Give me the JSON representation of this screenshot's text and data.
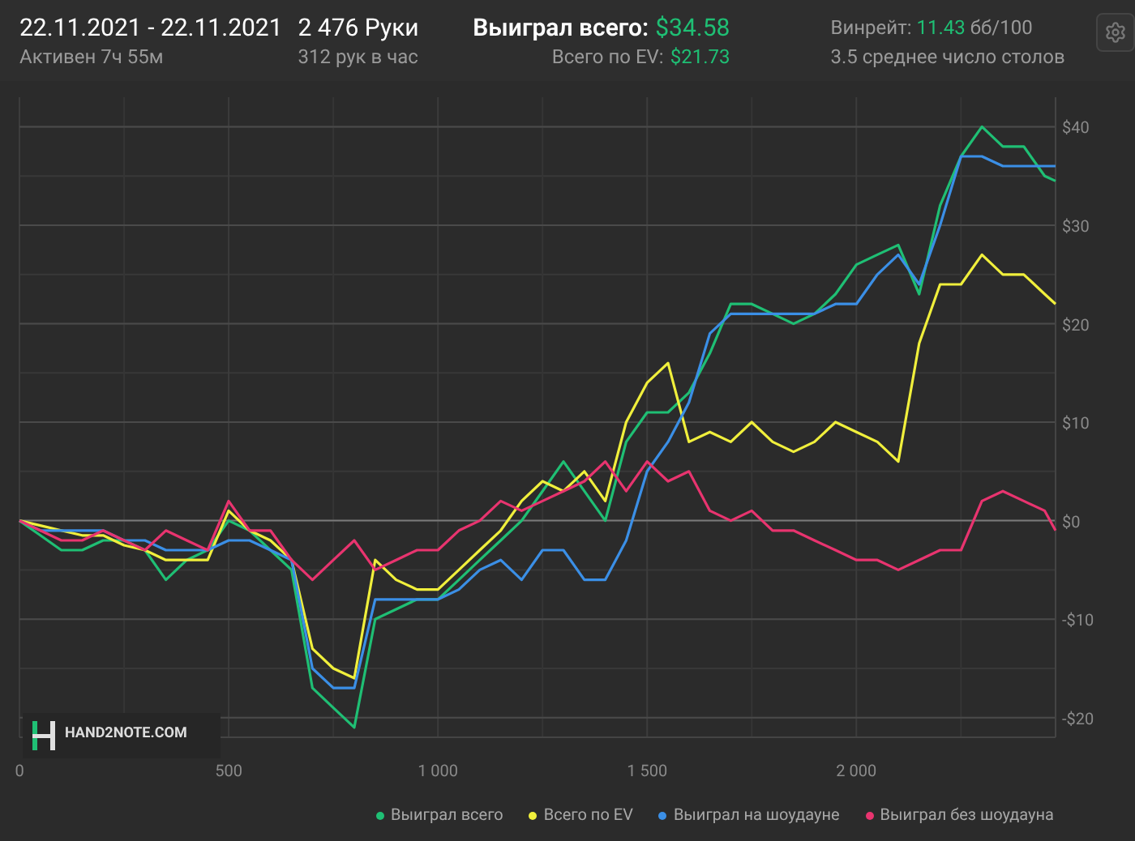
{
  "header": {
    "date_range": "22.11.2021 - 22.11.2021",
    "active": "Активен 7ч 55м",
    "hands": "2 476 Руки",
    "hands_per_hour": "312 рук в час",
    "won_label": "Выиграл всего:",
    "won_value": "$34.58",
    "ev_label": "Всего по EV:",
    "ev_value": "$21.73",
    "winrate_label": "Винрейт:",
    "winrate_value": "11.43",
    "winrate_unit": "бб/100",
    "tables": "3.5 среднее число столов"
  },
  "logo": {
    "text": "HAND2NOTE.COM"
  },
  "chart": {
    "chart_data": {
      "type": "line",
      "x": [
        0,
        50,
        100,
        150,
        200,
        250,
        300,
        350,
        400,
        450,
        500,
        550,
        600,
        650,
        700,
        750,
        800,
        850,
        900,
        950,
        1000,
        1050,
        1100,
        1150,
        1200,
        1250,
        1300,
        1350,
        1400,
        1450,
        1500,
        1550,
        1600,
        1650,
        1700,
        1750,
        1800,
        1850,
        1900,
        1950,
        2000,
        2050,
        2100,
        2150,
        2200,
        2250,
        2300,
        2350,
        2400,
        2450,
        2476
      ],
      "series": [
        {
          "name": "Выиграл всего",
          "color": "#1fbf74",
          "values": [
            0,
            -1.5,
            -3,
            -3,
            -2,
            -2,
            -3,
            -6,
            -4,
            -3,
            0,
            -1,
            -3,
            -5,
            -17,
            -19,
            -21,
            -10,
            -9,
            -8,
            -8,
            -6,
            -4,
            -2,
            0,
            3,
            6,
            3,
            0,
            8,
            11,
            11,
            13,
            17,
            22,
            22,
            21,
            20,
            21,
            23,
            26,
            27,
            28,
            23,
            32,
            37,
            40,
            38,
            38,
            35,
            34.5
          ]
        },
        {
          "name": "Всего по EV",
          "color": "#f0ef3c",
          "values": [
            0,
            -0.5,
            -1,
            -1.5,
            -1.5,
            -2.5,
            -3,
            -4,
            -4,
            -4,
            1,
            -1,
            -2,
            -4,
            -13,
            -15,
            -16,
            -4,
            -6,
            -7,
            -7,
            -5,
            -3,
            -1,
            2,
            4,
            3,
            5,
            2,
            10,
            14,
            16,
            8,
            9,
            8,
            10,
            8,
            7,
            8,
            10,
            9,
            8,
            6,
            18,
            24,
            24,
            27,
            25,
            25,
            23,
            22
          ]
        },
        {
          "name": "Выиграл на шоудауне",
          "color": "#3b8fe6",
          "values": [
            0,
            -1,
            -1,
            -1,
            -1,
            -2,
            -2,
            -3,
            -3,
            -3,
            -2,
            -2,
            -3,
            -4,
            -15,
            -17,
            -17,
            -8,
            -8,
            -8,
            -8,
            -7,
            -5,
            -4,
            -6,
            -3,
            -3,
            -6,
            -6,
            -2,
            5,
            8,
            12,
            19,
            21,
            21,
            21,
            21,
            21,
            22,
            22,
            25,
            27,
            24,
            30,
            37,
            37,
            36,
            36,
            36,
            36
          ]
        },
        {
          "name": "Выиграл без шоудауна",
          "color": "#e8346f",
          "values": [
            0,
            -1,
            -2,
            -2,
            -1,
            -2,
            -3,
            -1,
            -2,
            -3,
            2,
            -1,
            -1,
            -4,
            -6,
            -4,
            -2,
            -5,
            -4,
            -3,
            -3,
            -1,
            0,
            2,
            1,
            2,
            3,
            4,
            6,
            3,
            6,
            4,
            5,
            1,
            0,
            1,
            -1,
            -1,
            -2,
            -3,
            -4,
            -4,
            -5,
            -4,
            -3,
            -3,
            2,
            3,
            2,
            1,
            -1
          ]
        }
      ],
      "grid": true,
      "xlim": [
        0,
        2476
      ],
      "ylim": [
        -22,
        43
      ],
      "xticks": [
        0,
        {
          "value": 500,
          "label": "500"
        },
        {
          "value": 1000,
          "label": "1 000"
        },
        {
          "value": 1500,
          "label": "1 500"
        },
        {
          "value": 2000,
          "label": "2 000"
        }
      ],
      "yticks": [
        {
          "value": 40,
          "label": "$40"
        },
        {
          "value": 30,
          "label": "$30"
        },
        {
          "value": 20,
          "label": "$20"
        },
        {
          "value": 10,
          "label": "$10"
        },
        {
          "value": 0,
          "label": "$0"
        },
        {
          "value": -10,
          "label": "-$10"
        },
        {
          "value": -20,
          "label": "-$20"
        }
      ]
    }
  }
}
